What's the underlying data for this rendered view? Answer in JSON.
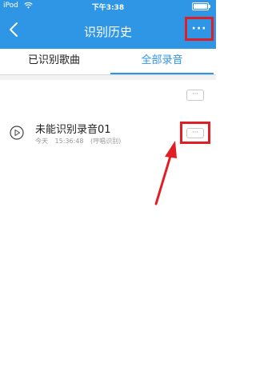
{
  "status_bar": {
    "carrier": "iPod",
    "time": "下午3:38"
  },
  "nav": {
    "title": "识别历史",
    "more_label": "···"
  },
  "tabs": [
    {
      "label": "已识别歌曲",
      "active": false
    },
    {
      "label": "全部录音",
      "active": true
    }
  ],
  "list": {
    "header_more_label": "···",
    "items": [
      {
        "title": "未能识别录音01",
        "date": "今天",
        "time": "15:36:48",
        "tag": "(哼唱识别)",
        "more_label": "···"
      }
    ]
  },
  "colors": {
    "primary": "#2f96e6",
    "highlight": "#e21e25"
  }
}
